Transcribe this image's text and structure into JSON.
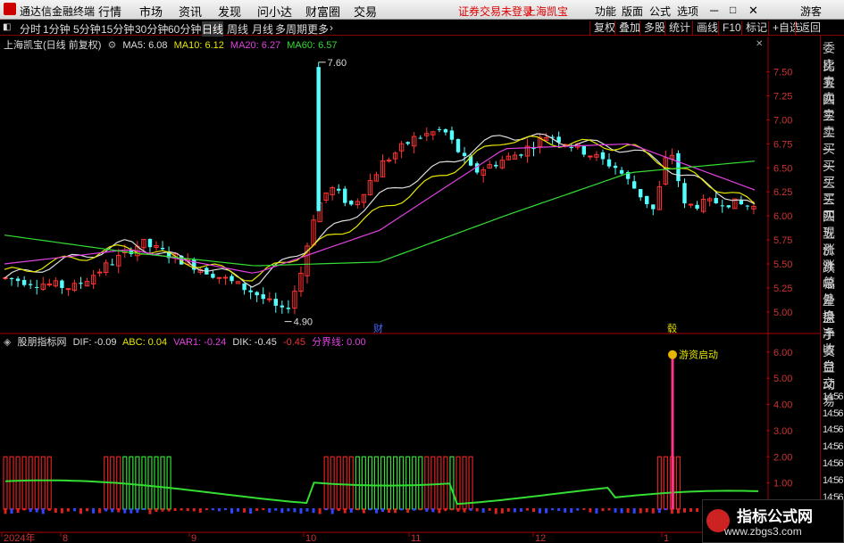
{
  "menubar": {
    "title": "通达信金融终端",
    "menus": [
      "行情",
      "市场",
      "资讯",
      "发现",
      "问小达",
      "财富圈",
      "交易"
    ],
    "status": "证券交易未登录",
    "stock": "上海凯宝",
    "right_items": [
      "功能",
      "版面",
      "公式",
      "选项"
    ],
    "guest": "游客"
  },
  "toolbar": {
    "periods": [
      "分时",
      "1分钟",
      "5分钟",
      "15分钟",
      "30分钟",
      "60分钟",
      "日线",
      "周线",
      "月线",
      "多周期",
      "更多"
    ],
    "active_period": "日线",
    "right_buttons": [
      "复权",
      "叠加",
      "多股",
      "统计",
      "画线",
      "F10",
      "标记",
      "+自选",
      "返回"
    ]
  },
  "main_legend": {
    "stock_label": "上海凯宝(日线 前复权)",
    "items": [
      {
        "text": "MA5: 6.08",
        "color": "#dddddd"
      },
      {
        "text": "MA10: 6.12",
        "color": "#e6e600"
      },
      {
        "text": "MA20: 6.27",
        "color": "#e040e0"
      },
      {
        "text": "MA60: 6.57",
        "color": "#33dd33"
      }
    ]
  },
  "price_axis": [
    "7.50",
    "7.25",
    "7.00",
    "6.75",
    "6.50",
    "6.25",
    "6.00",
    "5.75",
    "5.50",
    "5.25",
    "5.00"
  ],
  "price_marks": {
    "high": "7.60",
    "low": "4.90"
  },
  "event_marks": [
    "财",
    "毂"
  ],
  "indicator_legend": {
    "name": "股朋指标网",
    "items": [
      {
        "text": "DIF: -0.09",
        "color": "#dddddd"
      },
      {
        "text": "ABC: 0.04",
        "color": "#e6e600"
      },
      {
        "text": "VAR1: -0.24",
        "color": "#e040e0"
      },
      {
        "text": "DIK: -0.45",
        "color": "#dddddd"
      },
      {
        "text": "-0.45",
        "color": "#ee3333"
      },
      {
        "text": "分界线: 0.00",
        "color": "#e040e0"
      }
    ]
  },
  "indicator_axis": [
    "6.00",
    "5.00",
    "4.00",
    "3.00",
    "2.00",
    "1.00"
  ],
  "indicator_annotation": "游资启动",
  "date_axis": [
    "2024年",
    "8",
    "9",
    "10",
    "11",
    "12",
    "1"
  ],
  "right_panel": [
    "委比",
    "卖五",
    "卖四",
    "卖三",
    "卖二",
    "卖一",
    "买一",
    "买二",
    "买三",
    "买四",
    "买五",
    "现价",
    "涨跌",
    "涨幅",
    "总量",
    "外盘",
    "换手",
    "净资",
    "收益",
    "自动",
    "交易",
    "14:56",
    "14:56",
    "14:56",
    "14:56",
    "14:56",
    "14:56",
    "14:56"
  ],
  "watermark": {
    "title": "指标公式网",
    "url": "www.zbgs3.com"
  },
  "chart_data": {
    "type": "line",
    "title": "上海凯宝(日线 前复权)",
    "x": [
      "2024-07",
      "2024-08",
      "2024-09",
      "2024-10",
      "2024-11",
      "2024-12",
      "2025-01"
    ],
    "series": [
      {
        "name": "MA5",
        "values": [
          5.35,
          5.72,
          5.3,
          6.2,
          6.85,
          6.7,
          6.08
        ]
      },
      {
        "name": "MA10",
        "values": [
          5.4,
          5.68,
          5.35,
          6.05,
          6.8,
          6.72,
          6.12
        ]
      },
      {
        "name": "MA20",
        "values": [
          5.5,
          5.65,
          5.4,
          5.85,
          6.7,
          6.75,
          6.27
        ]
      },
      {
        "name": "MA60",
        "values": [
          5.8,
          5.62,
          5.48,
          5.52,
          6.0,
          6.45,
          6.57
        ]
      }
    ],
    "ylim": [
      4.85,
      7.7
    ],
    "annotations": [
      {
        "text": "7.60",
        "value": 7.6
      },
      {
        "text": "4.90",
        "value": 4.9
      }
    ]
  }
}
